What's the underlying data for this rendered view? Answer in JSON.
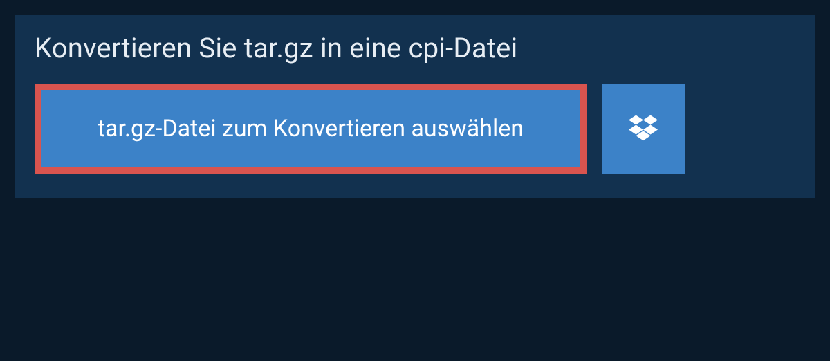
{
  "panel": {
    "heading": "Konvertieren Sie tar.gz in eine cpi-Datei",
    "select_button_label": "tar.gz-Datei zum Konvertieren auswählen"
  },
  "colors": {
    "background": "#0a1a2a",
    "panel": "#12314f",
    "button": "#3c82c8",
    "highlight_border": "#d9544f",
    "text_light": "#e8eef4",
    "text_white": "#ffffff"
  }
}
